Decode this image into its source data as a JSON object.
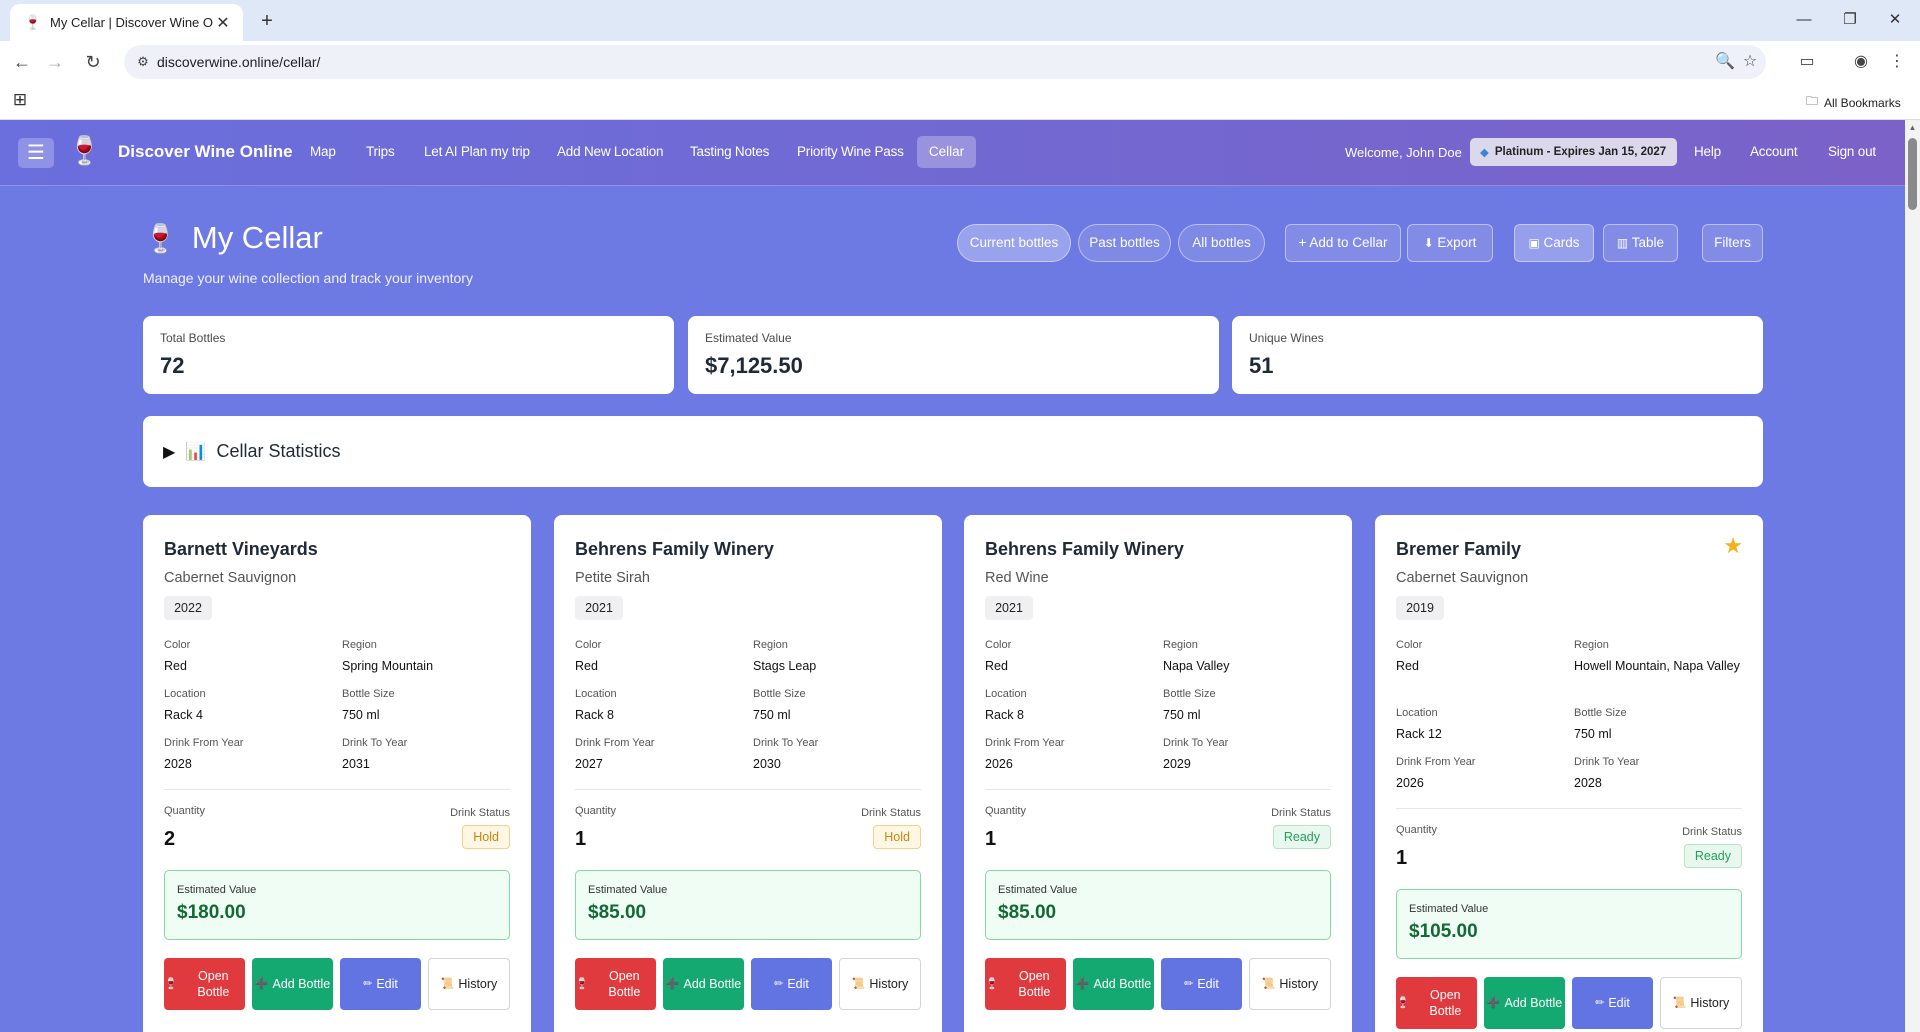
{
  "browser": {
    "tab_title": "My Cellar | Discover Wine Onlin",
    "url": "discoverwine.online/cellar/",
    "all_bookmarks": "All Bookmarks"
  },
  "site": {
    "brand": "Discover Wine Online",
    "nav": [
      "Map",
      "Trips",
      "Let AI Plan my trip",
      "Add New Location",
      "Tasting Notes",
      "Priority Wine Pass",
      "Cellar"
    ],
    "welcome": "Welcome, John Doe",
    "membership": "Platinum - Expires Jan 15, 2027",
    "right_links": [
      "Help",
      "Account",
      "Sign out"
    ]
  },
  "page": {
    "title": "My Cellar",
    "subtitle": "Manage your wine collection and track your inventory",
    "filter_pills": [
      "Current bottles",
      "Past bottles",
      "All bottles"
    ],
    "toolbar": {
      "add": "+ Add to Cellar",
      "export": "Export",
      "cards": "Cards",
      "table": "Table",
      "filters": "Filters"
    },
    "stats": [
      {
        "label": "Total Bottles",
        "value": "72"
      },
      {
        "label": "Estimated Value",
        "value": "$7,125.50"
      },
      {
        "label": "Unique Wines",
        "value": "51"
      }
    ],
    "cellar_statistics": "Cellar Statistics"
  },
  "labels": {
    "color": "Color",
    "region": "Region",
    "location": "Location",
    "bottle_size": "Bottle Size",
    "drink_from": "Drink From Year",
    "drink_to": "Drink To Year",
    "quantity": "Quantity",
    "drink_status": "Drink Status",
    "estimated_value": "Estimated Value",
    "open_bottle": "Open Bottle",
    "add_bottle": "Add Bottle",
    "edit": "Edit",
    "history": "History"
  },
  "wines": [
    {
      "producer": "Barnett Vineyards",
      "varietal": "Cabernet Sauvignon",
      "vintage": "2022",
      "color": "Red",
      "region": "Spring Mountain",
      "location": "Rack 4",
      "bottle_size": "750 ml",
      "drink_from": "2028",
      "drink_to": "2031",
      "quantity": "2",
      "status": "Hold",
      "value": "$180.00",
      "favorite": false
    },
    {
      "producer": "Behrens Family Winery",
      "varietal": "Petite Sirah",
      "vintage": "2021",
      "color": "Red",
      "region": "Stags Leap",
      "location": "Rack 8",
      "bottle_size": "750 ml",
      "drink_from": "2027",
      "drink_to": "2030",
      "quantity": "1",
      "status": "Hold",
      "value": "$85.00",
      "favorite": false
    },
    {
      "producer": "Behrens Family Winery",
      "varietal": "Red Wine",
      "vintage": "2021",
      "color": "Red",
      "region": "Napa Valley",
      "location": "Rack 8",
      "bottle_size": "750 ml",
      "drink_from": "2026",
      "drink_to": "2029",
      "quantity": "1",
      "status": "Ready",
      "value": "$85.00",
      "favorite": false
    },
    {
      "producer": "Bremer Family",
      "varietal": "Cabernet Sauvignon",
      "vintage": "2019",
      "color": "Red",
      "region": "Howell Mountain, Napa Valley",
      "location": "Rack 12",
      "bottle_size": "750 ml",
      "drink_from": "2026",
      "drink_to": "2028",
      "quantity": "1",
      "status": "Ready",
      "value": "$105.00",
      "favorite": true
    }
  ]
}
